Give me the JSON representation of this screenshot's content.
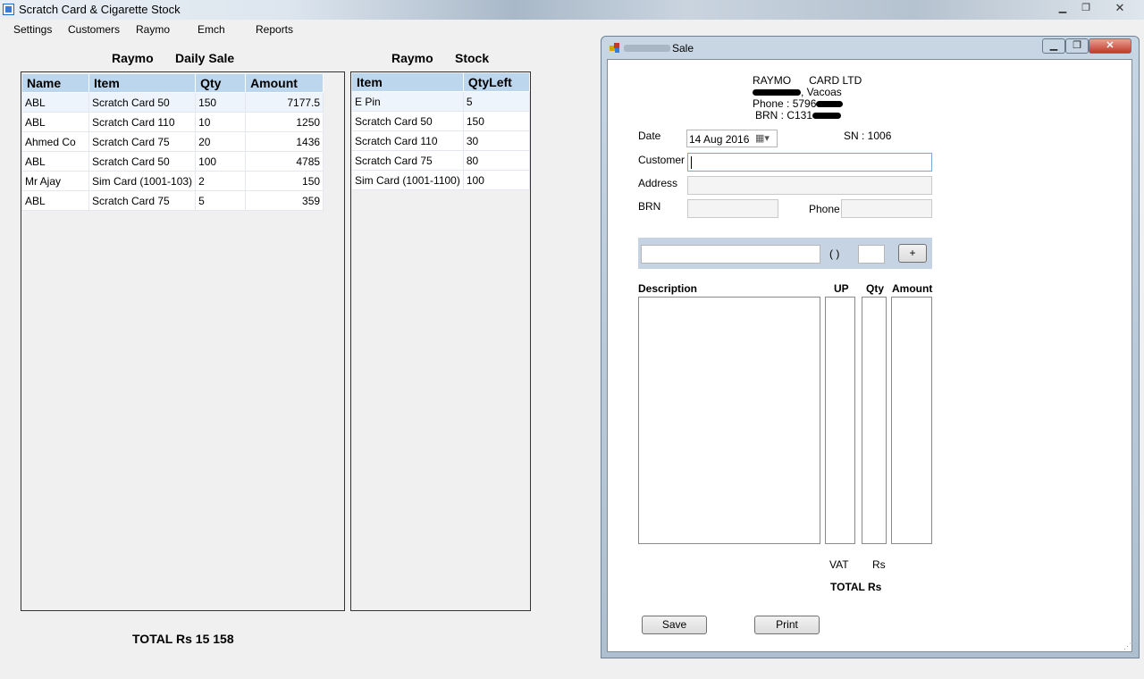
{
  "window": {
    "title": "Scratch Card & Cigarette Stock"
  },
  "menu": [
    "Settings",
    "Customers",
    "Raymo",
    "Emch",
    "Reports"
  ],
  "daily_sale": {
    "heading_left": "Raymo",
    "heading_right": "Daily Sale",
    "columns": [
      "Name",
      "Item",
      "Qty",
      "Amount"
    ],
    "rows": [
      [
        "ABL",
        "Scratch Card 50",
        "150",
        "7177.5"
      ],
      [
        "ABL",
        "Scratch Card 110",
        "10",
        "1250"
      ],
      [
        "Ahmed Co",
        "Scratch Card 75",
        "20",
        "1436"
      ],
      [
        "ABL",
        "Scratch Card 50",
        "100",
        "4785"
      ],
      [
        "Mr Ajay",
        "Sim Card (1001-103)",
        "2",
        "150"
      ],
      [
        "ABL",
        "Scratch Card 75",
        "5",
        "359"
      ]
    ],
    "total": "TOTAL Rs 15 158"
  },
  "stock": {
    "heading_left": "Raymo",
    "heading_right": "Stock",
    "columns": [
      "Item",
      "QtyLeft"
    ],
    "rows": [
      [
        "E Pin",
        "5"
      ],
      [
        "Scratch Card 50",
        "150"
      ],
      [
        "Scratch Card 110",
        "30"
      ],
      [
        "Scratch Card 75",
        "80"
      ],
      [
        "Sim Card (1001-1100)",
        "100"
      ]
    ]
  },
  "sale_window": {
    "title": "Sale",
    "company_line1": "RAYMO      CARD LTD",
    "address_suffix": ", Vacoas",
    "phone": "Phone : 5796",
    "brn": "BRN : C131",
    "date_label": "Date",
    "date_value": "14 Aug 2016",
    "sn": "SN : 1006",
    "customer_label": "Customer",
    "customer_value": "",
    "address_label": "Address",
    "brn_label": "BRN",
    "phone_label": "Phone",
    "parens": "( )",
    "add_button": "+",
    "columns": {
      "description": "Description",
      "up": "UP",
      "qty": "Qty",
      "amount": "Amount"
    },
    "vat_label": "VAT",
    "rs_label": "Rs",
    "total_label": "TOTAL Rs",
    "save_button": "Save",
    "print_button": "Print"
  }
}
